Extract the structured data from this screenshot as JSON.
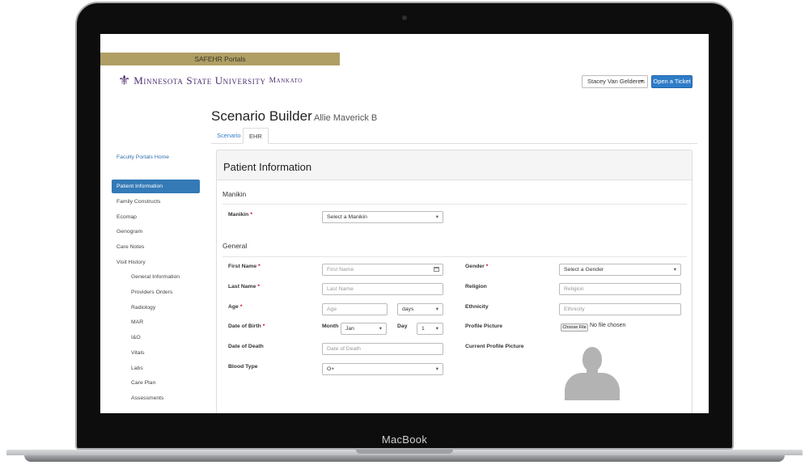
{
  "device": {
    "brand_label": "MacBook"
  },
  "header": {
    "portal_label": "SAFEHR Portals",
    "logo_glyph": "⚜",
    "logo_text_main": "Minnesota State University",
    "logo_text_sub": "Mankato",
    "user_name": "Stacey Van Gelderen",
    "ticket_button": "Open a Ticket"
  },
  "page": {
    "title": "Scenario Builder",
    "subtitle": "Allie Maverick B",
    "tabs": [
      {
        "label": "Scenario"
      },
      {
        "label": "EHR"
      }
    ],
    "active_tab": "EHR"
  },
  "sidebar": {
    "portal_home": "Faculty Portals Home",
    "items": [
      {
        "label": "Patient Information",
        "active": true
      },
      {
        "label": "Family Constructs"
      },
      {
        "label": "Ecomap"
      },
      {
        "label": "Genogram"
      },
      {
        "label": "Care Notes"
      },
      {
        "label": "Visit History"
      }
    ],
    "sub_items": [
      {
        "label": "General Information"
      },
      {
        "label": "Providers Orders"
      },
      {
        "label": "Radiology"
      },
      {
        "label": "MAR"
      },
      {
        "label": "I&O"
      },
      {
        "label": "Vitals"
      },
      {
        "label": "Labs"
      },
      {
        "label": "Care Plan"
      },
      {
        "label": "Assessments"
      }
    ]
  },
  "panel": {
    "title": "Patient Information",
    "manikin_section": "Manikin",
    "manikin_label": "Manikin",
    "manikin_placeholder": "Select a Manikin",
    "general_section": "General",
    "first_name_label": "First Name",
    "first_name_placeholder": "First Name",
    "last_name_label": "Last Name",
    "last_name_placeholder": "Last Name",
    "age_label": "Age",
    "age_placeholder": "Age",
    "age_unit": "days",
    "dob_label": "Date of Birth",
    "month_label": "Month",
    "month_value": "Jan",
    "day_label": "Day",
    "day_value": "1",
    "dod_label": "Date of Death",
    "dod_placeholder": "Date of Death",
    "blood_type_label": "Blood Type",
    "blood_type_value": "O+",
    "gender_label": "Gender",
    "gender_placeholder": "Select a Gender",
    "religion_label": "Religion",
    "religion_placeholder": "Religion",
    "ethnicity_label": "Ethnicity",
    "ethnicity_placeholder": "Ethnicity",
    "profile_picture_label": "Profile Picture",
    "file_button": "Choose File",
    "file_status": "No file chosen",
    "current_picture_label": "Current Profile Picture",
    "required_mark": "*"
  },
  "colors": {
    "gold_bar": "#af9f64",
    "primary": "#2f7cc8",
    "purple_logo": "#4b2c6f",
    "required": "#d0021b"
  }
}
